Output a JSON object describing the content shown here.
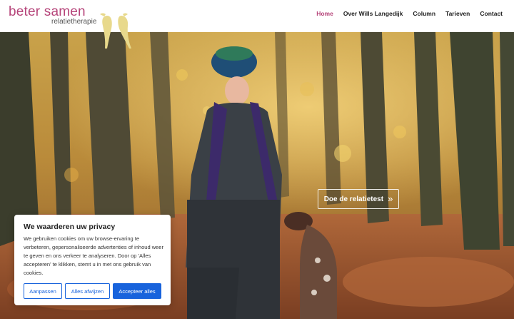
{
  "brand": {
    "name": "beter samen",
    "subtitle": "relatietherapie",
    "color": "#b6457a",
    "logo_icon": "two-birds-icon"
  },
  "nav": {
    "items": [
      {
        "label": "Home",
        "active": true
      },
      {
        "label": "Over Wills Langedijk",
        "active": false
      },
      {
        "label": "Column",
        "active": false
      },
      {
        "label": "Tarieven",
        "active": false
      },
      {
        "label": "Contact",
        "active": false
      }
    ]
  },
  "hero": {
    "cta_label": "Doe de relatietest",
    "cta_icon": "double-chevron-right-icon"
  },
  "cookie": {
    "title": "We waarderen uw privacy",
    "text": "We gebruiken cookies om uw browse-ervaring te verbeteren, gepersonaliseerde advertenties of inhoud weer te geven en ons verkeer te analyseren. Door op 'Alles accepteren' te klikken, stemt u in met ons gebruik van cookies.",
    "customize_label": "Aanpassen",
    "reject_label": "Alles afwijzen",
    "accept_label": "Accepteer alles",
    "accent": "#1863dc"
  }
}
